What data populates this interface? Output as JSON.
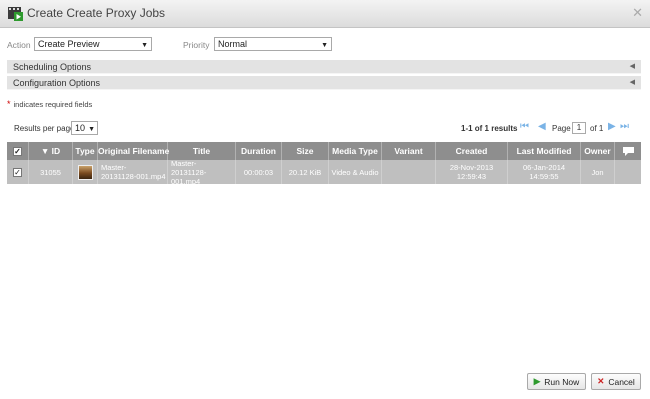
{
  "window": {
    "title": "Create Create Proxy Jobs",
    "close_glyph": "✕"
  },
  "form": {
    "action_label": "Action",
    "action_value": "Create Preview",
    "priority_label": "Priority",
    "priority_value": "Normal"
  },
  "panels": {
    "scheduling": "Scheduling Options",
    "configuration": "Configuration Options"
  },
  "required_note": "indicates required fields",
  "results": {
    "per_page_label": "Results per page",
    "per_page_value": "10",
    "range_text": "1-1 of 1 results",
    "page_label": "Page",
    "page_value": "1",
    "of_text": "of 1"
  },
  "table": {
    "headers": {
      "id": "ID",
      "type": "Type",
      "original_filename": "Original Filename",
      "title": "Title",
      "duration": "Duration",
      "size": "Size",
      "media_type": "Media Type",
      "variant": "Variant",
      "created": "Created",
      "last_modified": "Last Modified",
      "owner": "Owner"
    },
    "rows": [
      {
        "id": "31055",
        "original_filename": "Master-\n20131128-001.mp4",
        "title": "Master-\n20131128-001.mp4",
        "duration": "00:00:03",
        "size": "20.12 KiB",
        "media_type": "Video & Audio",
        "variant": "",
        "created": "28-Nov-2013\n12:59:43",
        "last_modified": "06-Jan-2014\n14:59:55",
        "owner": "Jon"
      }
    ]
  },
  "buttons": {
    "run": "Run Now",
    "cancel": "Cancel"
  },
  "colors": {
    "header_bg": "#8e8e8e",
    "row_bg": "#bfbfbf",
    "panel_bg": "#e3e3e3",
    "run_icon": "#2e9a2e",
    "cancel_icon": "#cc2222",
    "pager_icon": "#7ab3e6"
  },
  "icons": [
    "app-icon",
    "close-icon",
    "collapse-arrow-icon",
    "required-star-icon",
    "first-page-icon",
    "previous-page-icon",
    "next-page-icon",
    "last-page-icon",
    "comment-icon",
    "run-icon",
    "cancel-icon"
  ]
}
